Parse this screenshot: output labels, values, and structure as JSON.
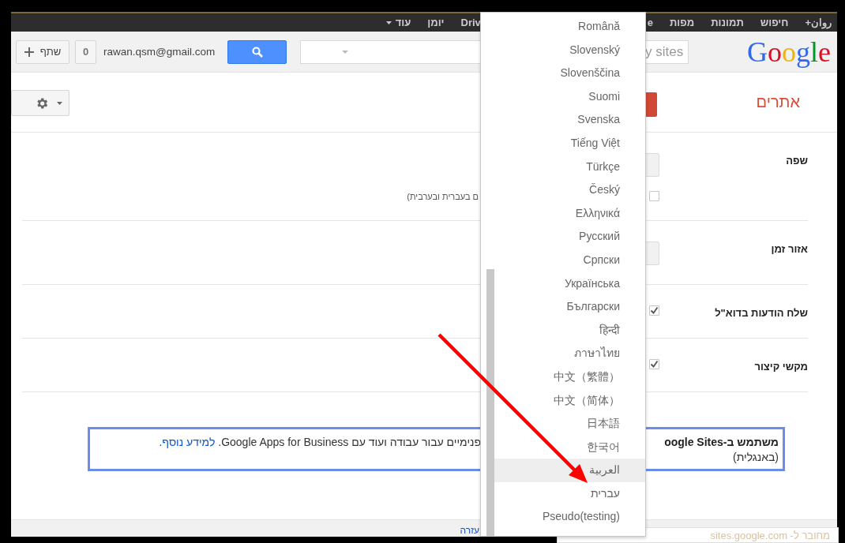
{
  "top_bar": {
    "right_items": [
      {
        "label": "+روان",
        "dropdown": false
      },
      {
        "label": "חיפוש",
        "dropdown": false
      },
      {
        "label": "תמונות",
        "dropdown": false
      },
      {
        "label": "מפות",
        "dropdown": false
      },
      {
        "label": "e",
        "dropdown": false
      }
    ],
    "left_items": [
      {
        "label": "Driv",
        "dropdown": false
      },
      {
        "label": "יומן",
        "dropdown": false
      },
      {
        "label": "עוד",
        "dropdown": true
      }
    ]
  },
  "header": {
    "share_button": "שתף",
    "count_button": "0",
    "account": "rawan.qsm@gmail.com",
    "search": {
      "placeholder": "y sites"
    },
    "logo": "Google"
  },
  "title": "אתרים",
  "settings": [
    {
      "label": "שפה",
      "controls": [
        {
          "kind": "select"
        },
        {
          "kind": "checkbox",
          "checked": false,
          "text": "ם בעברית ובערבית)"
        }
      ]
    },
    {
      "label": "אזור זמן",
      "controls": [
        {
          "kind": "select"
        }
      ]
    },
    {
      "label": "שלח הודעות בדוא\"ל",
      "controls": [
        {
          "kind": "checkbox",
          "checked": true
        }
      ]
    },
    {
      "label": "מקשי קיצור",
      "controls": [
        {
          "kind": "checkbox",
          "checked": true
        }
      ]
    }
  ],
  "info_box": {
    "heading": "משתמש ב-oogle Sites",
    "subheading": "(באנגלית)",
    "text": "פנימיים עבור עבודה ועוד עם Google Apps for Business. ",
    "link": "למידע נוסף",
    "text_after": "."
  },
  "footer": {
    "help_link": "עזרה",
    "status": "מחובר ל- sites.google.com"
  },
  "language_menu": {
    "items": [
      {
        "label": "Română",
        "selected": false
      },
      {
        "label": "Slovenský",
        "selected": false
      },
      {
        "label": "Slovenščina",
        "selected": false
      },
      {
        "label": "Suomi",
        "selected": false
      },
      {
        "label": "Svenska",
        "selected": false
      },
      {
        "label": "Tiếng Việt",
        "selected": false
      },
      {
        "label": "Türkçe",
        "selected": false
      },
      {
        "label": "Český",
        "selected": false
      },
      {
        "label": "Ελληνικά",
        "selected": false
      },
      {
        "label": "Русский",
        "selected": false
      },
      {
        "label": "Српски",
        "selected": false
      },
      {
        "label": "Українська",
        "selected": false
      },
      {
        "label": "Български",
        "selected": false
      },
      {
        "label": "हिन्दी",
        "selected": false
      },
      {
        "label": "ภาษาไทย",
        "selected": false
      },
      {
        "label": "中文（繁體）",
        "selected": false
      },
      {
        "label": "中文（简体）",
        "selected": false
      },
      {
        "label": "日本語",
        "selected": false
      },
      {
        "label": "한국어",
        "selected": false
      },
      {
        "label": "العربية",
        "selected": true
      },
      {
        "label": "עברית",
        "selected": false
      },
      {
        "label": "Pseudo(testing)",
        "selected": false
      }
    ]
  }
}
